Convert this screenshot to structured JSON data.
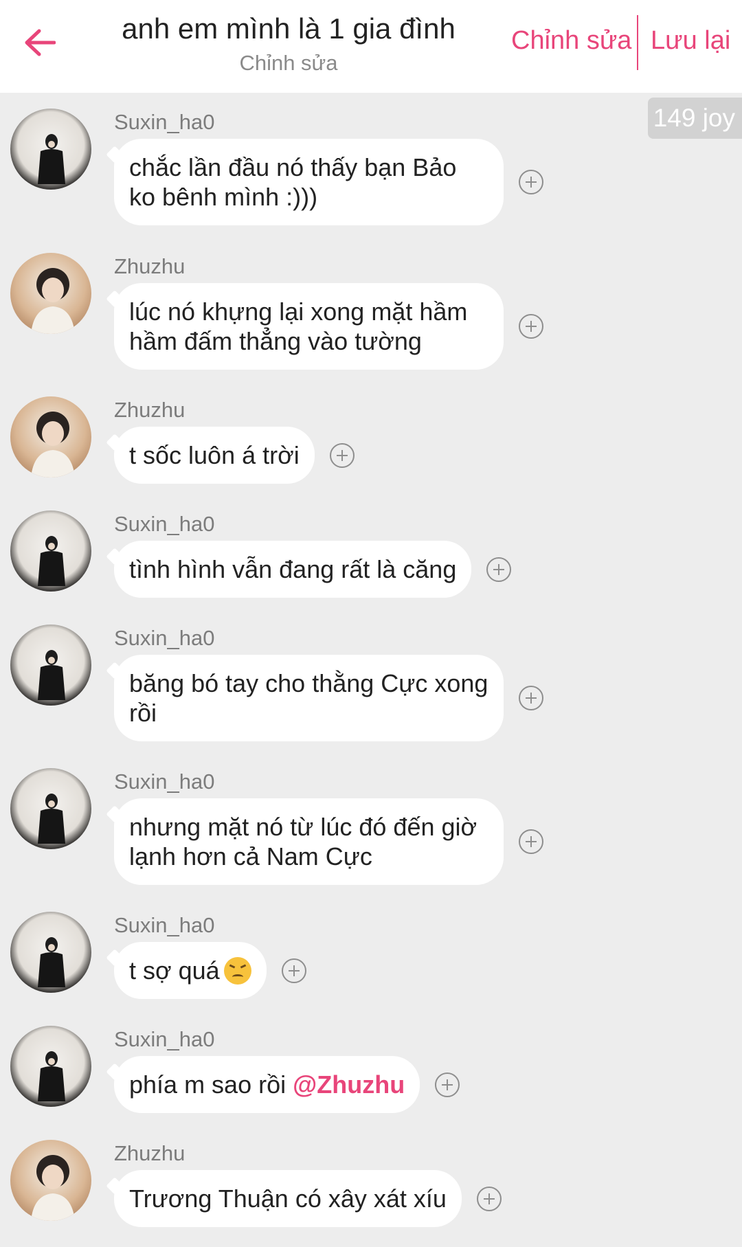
{
  "header": {
    "title": "anh em mình là 1 gia đình",
    "subtitle": "Chỉnh sửa",
    "edit_label": "Chỉnh sửa",
    "save_label": "Lưu lại",
    "accent_color": "#e8457a"
  },
  "joy_badge": "149 joy",
  "messages": [
    {
      "sender": "Suxin_ha0",
      "text": "chắc lần đầu nó thấy bạn Bảo ko bênh mình :)))",
      "avatar": "avatar-dark"
    },
    {
      "sender": "Zhuzhu",
      "text": "lúc nó khựng lại xong mặt hầm hầm đấm thẳng vào tường",
      "avatar": "avatar-warm"
    },
    {
      "sender": "Zhuzhu",
      "text": "t sốc luôn á trời",
      "avatar": "avatar-warm"
    },
    {
      "sender": "Suxin_ha0",
      "text": "tình hình vẫn đang rất là căng",
      "avatar": "avatar-dark"
    },
    {
      "sender": "Suxin_ha0",
      "text": "băng bó tay cho thằng Cực xong rồi",
      "avatar": "avatar-dark"
    },
    {
      "sender": "Suxin_ha0",
      "text": "nhưng mặt nó từ lúc đó đến giờ lạnh hơn cả Nam Cực",
      "avatar": "avatar-dark"
    },
    {
      "sender": "Suxin_ha0",
      "text": "t sợ quá",
      "emoji": "confounded-face",
      "avatar": "avatar-dark"
    },
    {
      "sender": "Suxin_ha0",
      "text": "phía m sao rồi ",
      "mention": "@Zhuzhu",
      "avatar": "avatar-dark"
    },
    {
      "sender": "Zhuzhu",
      "text": "Trương Thuận có xây xát xíu",
      "avatar": "avatar-warm"
    }
  ]
}
